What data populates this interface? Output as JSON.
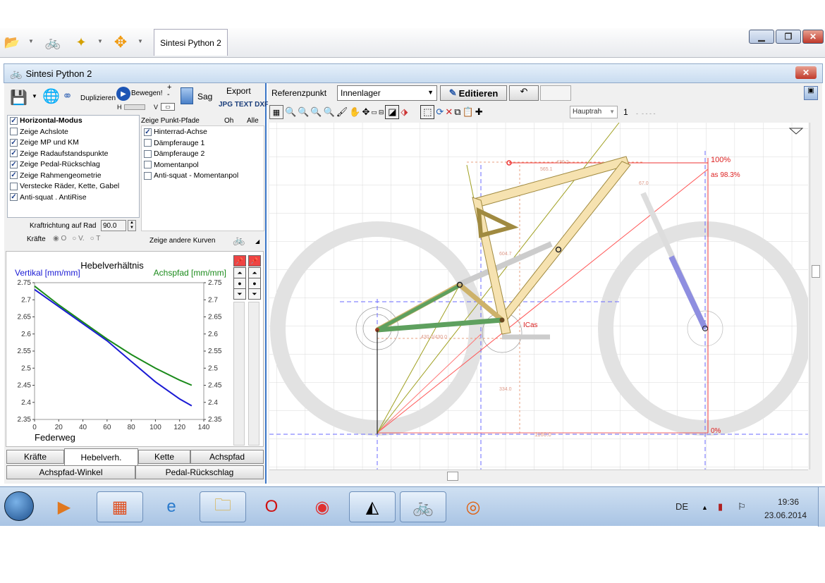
{
  "outer_tab": "Sintesi Python 2",
  "window_title": "Sintesi Python 2",
  "toolbar": {
    "duplizieren": "Duplizieren",
    "bewegen": "Bewegen!",
    "h": "H",
    "v": "V",
    "sag": "Sag",
    "export": "Export",
    "export_formats": "JPG TEXT DXF"
  },
  "checkboxes_left": [
    {
      "label": "Horizontal-Modus",
      "checked": true
    },
    {
      "label": "Zeige Achslote",
      "checked": false
    },
    {
      "label": "Zeige MP und KM",
      "checked": true
    },
    {
      "label": "Zeige Radaufstandspunkte",
      "checked": true
    },
    {
      "label": "Zeige Pedal-Rückschlag",
      "checked": true
    },
    {
      "label": "Zeige Rahmengeometrie",
      "checked": true
    },
    {
      "label": "Verstecke Räder, Kette, Gabel",
      "checked": false
    },
    {
      "label": "Anti-squat . AntiRise",
      "checked": true
    }
  ],
  "paths_header": {
    "title": "Zeige Punkt-Pfade",
    "oh": "Oh",
    "alle": "Alle"
  },
  "checkboxes_paths": [
    {
      "label": "Hinterrad-Achse",
      "checked": true
    },
    {
      "label": "Dämpferauge 1",
      "checked": false
    },
    {
      "label": "Dämpferauge 2",
      "checked": false
    },
    {
      "label": "Momentanpol",
      "checked": false
    },
    {
      "label": "Anti-squat - Momentanpol",
      "checked": false
    }
  ],
  "kraftrichtung": {
    "label": "Kraftrichtung auf Rad",
    "value": "90.0"
  },
  "kraefte": {
    "label": "Kräfte",
    "options": [
      "O",
      "V.",
      "T"
    ]
  },
  "zeige_andere": "Zeige andere Kurven",
  "chart_data": {
    "type": "line",
    "title": "Hebelverhältnis",
    "ylabel_left": "Vertikal [mm/mm]",
    "ylabel_right": "Achspfad [mm/mm]",
    "xlabel": "Federweg",
    "xlim": [
      0,
      140
    ],
    "ylim": [
      2.35,
      2.75
    ],
    "xticks": [
      "0",
      "20",
      "40",
      "60",
      "80",
      "100",
      "120",
      "140"
    ],
    "yticks": [
      "2.75",
      "2.7",
      "2.65",
      "2.6",
      "2.55",
      "2.5",
      "2.45",
      "2.4",
      "2.35"
    ],
    "series": [
      {
        "name": "Vertikal [mm/mm]",
        "color": "#1a1ad4",
        "x": [
          0,
          20,
          40,
          60,
          80,
          100,
          120,
          130
        ],
        "y": [
          2.73,
          2.68,
          2.63,
          2.58,
          2.52,
          2.46,
          2.41,
          2.39
        ]
      },
      {
        "name": "Achspfad [mm/mm]",
        "color": "#1a8a1a",
        "x": [
          0,
          20,
          40,
          60,
          80,
          100,
          120,
          130
        ],
        "y": [
          2.74,
          2.685,
          2.635,
          2.585,
          2.54,
          2.5,
          2.465,
          2.45
        ]
      }
    ]
  },
  "bottom_tabs_row1": [
    "Kräfte",
    "Hebelverh.",
    "Kette",
    "Achspfad"
  ],
  "bottom_tabs_row2": [
    "Achspfad-Winkel",
    "Pedal-Rückschlag"
  ],
  "right_toolbar": {
    "referenzpunkt_label": "Referenzpunkt",
    "referenzpunkt_value": "Innenlager",
    "editieren": "Editieren",
    "hauptrah": "Hauptrah",
    "count": "1"
  },
  "drawing_labels": {
    "p100": "100%",
    "as": "as 98.3%",
    "p0": "0%",
    "icas": "ICas",
    "d1160": "1160.0",
    "d4302": "430.2",
    "d5651": "565.1",
    "d4300": "430.0/430.0",
    "d334": "334.0",
    "d604": "604.7",
    "d670": "67.0"
  },
  "taskbar": {
    "lang": "DE",
    "time": "19:36",
    "date": "23.06.2014"
  }
}
